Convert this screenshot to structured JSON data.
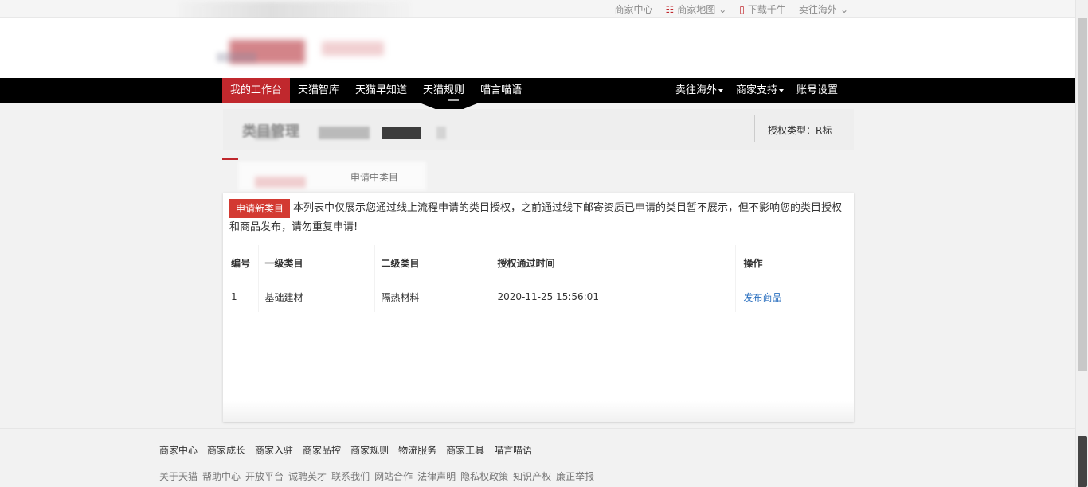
{
  "topbar": {
    "links": [
      {
        "label": "商家中心",
        "icon": ""
      },
      {
        "label": "商家地图",
        "icon": "list-icon",
        "dropdown": true
      },
      {
        "label": "下载千牛",
        "icon": "phone-icon"
      },
      {
        "label": "卖往海外",
        "icon": "",
        "dropdown": true
      }
    ]
  },
  "nav": {
    "left": [
      "我的工作台",
      "天猫智库",
      "天猫早知道",
      "天猫规则",
      "喵言喵语"
    ],
    "right": [
      {
        "label": "卖往海外",
        "dropdown": true
      },
      {
        "label": "商家支持",
        "dropdown": true
      },
      {
        "label": "账号设置",
        "dropdown": false
      }
    ]
  },
  "page": {
    "title": "类目管理",
    "auth_type": "授权类型：R标",
    "subtab": "申请中类目"
  },
  "notice": {
    "button": "申请新类目",
    "text": "本列表中仅展示您通过线上流程申请的类目授权，之前通过线下邮寄资质已申请的类目暂不展示，但不影响您的类目授权和商品发布，请勿重复申请!"
  },
  "table": {
    "headers": [
      "编号",
      "一级类目",
      "二级类目",
      "授权通过时间",
      "操作"
    ],
    "rows": [
      {
        "id": "1",
        "level1": "基础建材",
        "level2": "隔热材料",
        "time": "2020-11-25 15:56:01",
        "action": "发布商品"
      }
    ]
  },
  "footer": {
    "row1": [
      "商家中心",
      "商家成长",
      "商家入驻",
      "商家品控",
      "商家规则",
      "物流服务",
      "商家工具",
      "喵言喵语"
    ],
    "row2": [
      "关于天猫",
      "帮助中心",
      "开放平台",
      "诚聘英才",
      "联系我们",
      "网站合作",
      "法律声明",
      "隐私权政策",
      "知识产权",
      "廉正举报"
    ]
  },
  "colors": {
    "brand_red": "#c0282d",
    "button_red": "#d33a32",
    "nav_bg": "#000000",
    "link_blue": "#2a6fbf"
  }
}
